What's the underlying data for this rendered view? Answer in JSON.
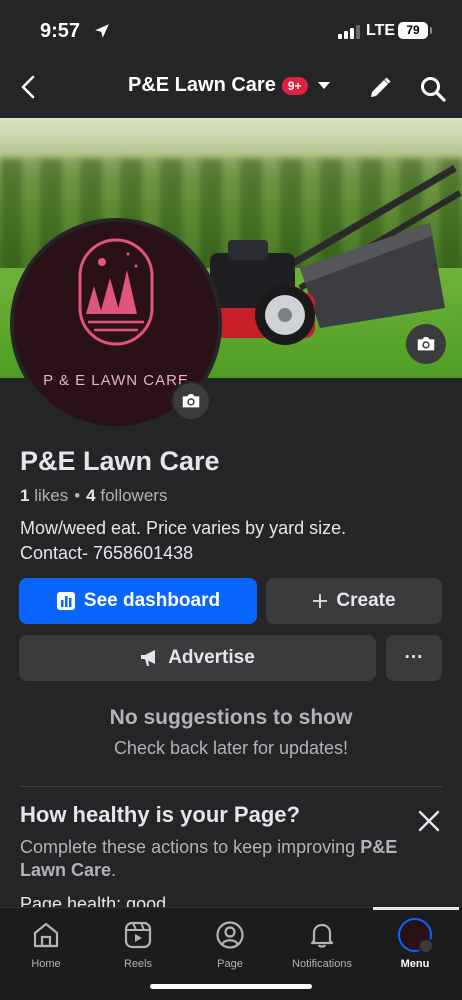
{
  "status_bar": {
    "time": "9:57",
    "network": "LTE",
    "battery": "79"
  },
  "header": {
    "title": "P&E Lawn Care",
    "notification_badge": "9+"
  },
  "profile": {
    "logo_text": "P & E LAWN CARE",
    "name": "P&E Lawn Care",
    "likes_count": "1",
    "likes_label": "likes",
    "separator": "•",
    "followers_count": "4",
    "followers_label": "followers",
    "bio_line1": "Mow/weed eat. Price varies by yard size.",
    "bio_line2": "Contact- 7658601438"
  },
  "actions": {
    "dashboard_label": "See dashboard",
    "create_label": "Create",
    "advertise_label": "Advertise",
    "more_label": "···"
  },
  "suggestions": {
    "heading": "No suggestions to show",
    "subtext": "Check back later for updates!"
  },
  "health": {
    "heading": "How healthy is your Page?",
    "text_prefix": "Complete these actions to keep improving ",
    "page_name": "P&E Lawn Care",
    "text_suffix": ".",
    "status": "Page health:  good"
  },
  "tabs": [
    {
      "label": "Home",
      "icon": "home-icon"
    },
    {
      "label": "Reels",
      "icon": "reels-icon"
    },
    {
      "label": "Page",
      "icon": "page-icon"
    },
    {
      "label": "Notifications",
      "icon": "bell-icon"
    },
    {
      "label": "Menu",
      "icon": "menu-avatar-icon"
    }
  ],
  "colors": {
    "accent": "#0866ff",
    "badge": "#e41e3f",
    "background": "#242526"
  }
}
